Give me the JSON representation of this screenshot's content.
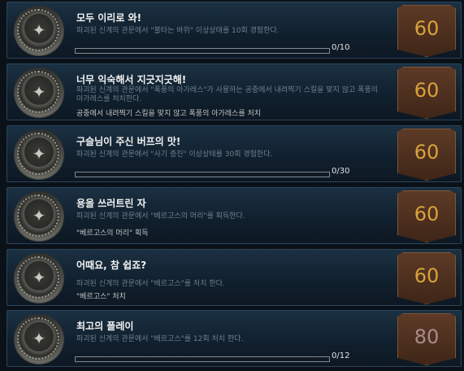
{
  "achievements": [
    {
      "title": "모두 이리로 와!",
      "desc": "파괴된 신계의 관문에서 \"불타는 바위\" 이상상태를 10회 경험한다.",
      "condition": "",
      "progress": "0/10",
      "progress_fraction": 0,
      "points": "60",
      "badge": "gold"
    },
    {
      "title": "너무 익숙해서 지긋지긋해!",
      "desc": "파괴된 신계의 관문에서 \"폭풍의 아가레스\"가 사용하는 공중에서 내려찍기 스킬을 맞지 않고 폭풍의 아가레스를 처치한다.",
      "condition": "공중에서 내려찍기 스킬을 맞지 않고 폭풍의 아가레스를 처치",
      "progress": "",
      "progress_fraction": null,
      "points": "60",
      "badge": "gold"
    },
    {
      "title": "구슬님이 주신 버프의 맛!",
      "desc": "파괴된 신계의 관문에서 \"사기 증진\" 이상상태를 30회 경험한다.",
      "condition": "",
      "progress": "0/30",
      "progress_fraction": 0,
      "points": "60",
      "badge": "gold"
    },
    {
      "title": "용을 쓰러트린 자",
      "desc": "파괴된 신계의 관문에서 \"베르고스의 머리\"를 획득한다.",
      "condition": "\"베르고스의 머리\" 획득",
      "progress": "",
      "progress_fraction": null,
      "points": "60",
      "badge": "gold"
    },
    {
      "title": "어때요, 참 쉽죠?",
      "desc": "파괴된 신계의 관문에서 \"베르고스\"를 처치 한다.",
      "condition": "\"베르고스\" 처치",
      "progress": "",
      "progress_fraction": null,
      "points": "60",
      "badge": "gold"
    },
    {
      "title": "최고의 플레이",
      "desc": "파괴된 신계의 관문에서 \"베르고스\"를 12회 처치 한다.",
      "condition": "",
      "progress": "0/12",
      "progress_fraction": 0,
      "points": "80",
      "badge": "grey"
    }
  ],
  "icons": {
    "medal": "achievement-medal-icon",
    "points_badge": "points-shield-icon"
  }
}
